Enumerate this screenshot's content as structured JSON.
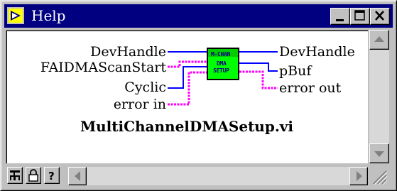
{
  "window": {
    "title": "Help"
  },
  "titlebar_buttons": {
    "minimize": "minimize",
    "maximize": "maximize",
    "close": "close"
  },
  "connector": {
    "inputs": [
      "DevHandle",
      "FAIDMAScanStart",
      "Cyclic",
      "error in"
    ],
    "outputs": [
      "DevHandle",
      "pBuf",
      "error out"
    ],
    "icon_text": [
      "M-CHAN",
      "DMA",
      "SETUP"
    ],
    "vi_name": "MultiChannelDMASetup.vi"
  },
  "colors": {
    "wire_pink": "#ff00ff",
    "wire_blue": "#0000ff",
    "icon_bg": "#00ff00",
    "titlebar": "#000080"
  }
}
